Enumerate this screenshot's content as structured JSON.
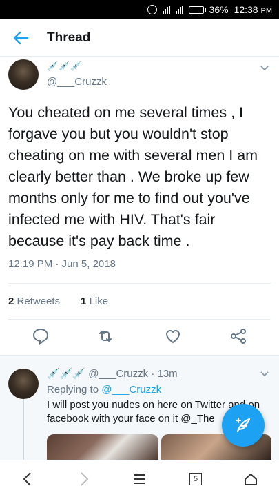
{
  "status_bar": {
    "battery": "36%",
    "time": "12:38",
    "ampm": "PM"
  },
  "header": {
    "title": "Thread",
    "back_icon": "back-arrow-icon"
  },
  "main_tweet": {
    "emojis": "💉💉💉",
    "handle": "@___Cruzzk",
    "text": "You cheated on me several times , I forgave you but you wouldn't stop cheating on me with several men I am clearly better than . We broke up few months only for me to find out you've infected me with HIV.  That's fair because it's pay back time .",
    "timestamp": "12:19 PM · Jun 5, 2018",
    "retweets_count": "2",
    "retweets_label": "Retweets",
    "likes_count": "1",
    "likes_label": "Like"
  },
  "reply_tweet": {
    "emojis": "💉💉💉",
    "handle": "@___Cruzzk",
    "time": "· 13m",
    "replying_to_label": "Replying to",
    "replying_to_handle": "@___Cruzzk",
    "text": "I will post you nudes on here on Twitter and on facebook with your face on it @_The"
  },
  "nav_bar": {
    "tab_count": "5"
  },
  "colors": {
    "accent": "#1da1f2",
    "muted": "#657786",
    "divider": "#e6ecf0"
  }
}
